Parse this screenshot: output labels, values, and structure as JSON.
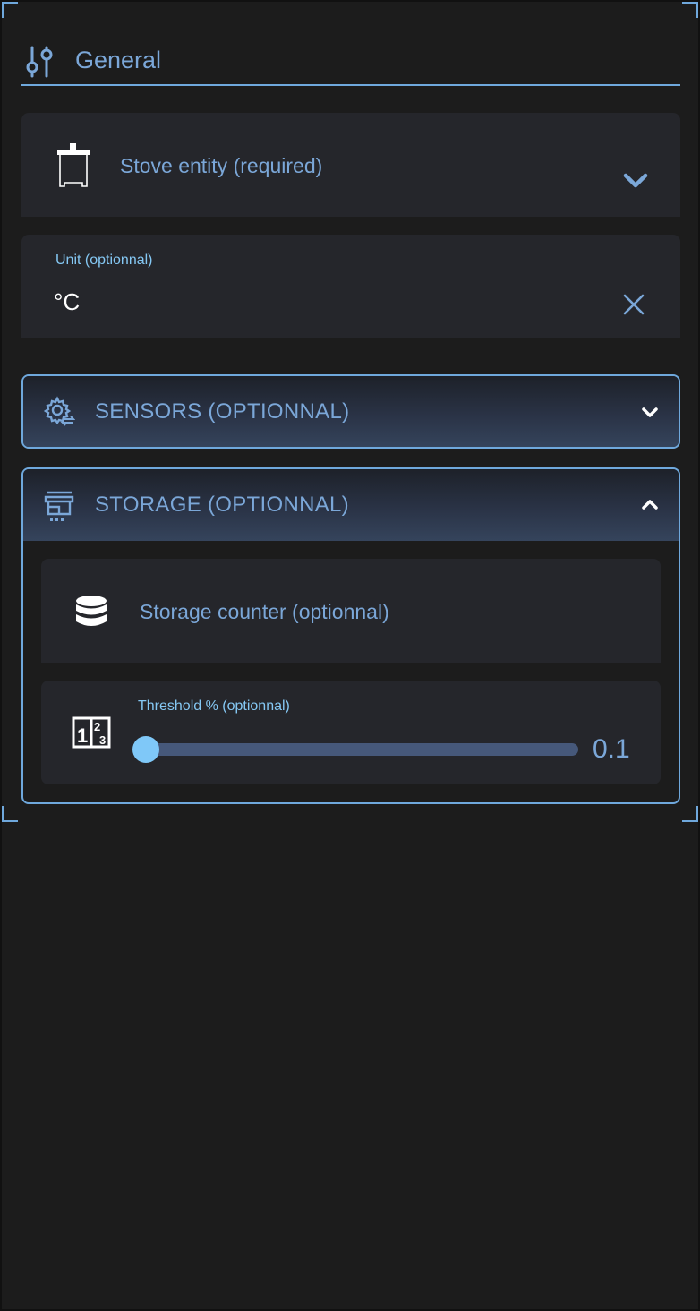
{
  "general": {
    "title": "General",
    "icon": "tune-icon"
  },
  "stove_entity": {
    "label": "Stove entity (required)",
    "icon": "stove-icon"
  },
  "unit": {
    "label": "Unit (optionnal)",
    "value": "°C"
  },
  "sensors": {
    "title": "SENSORS (OPTIONNAL)",
    "expanded": false,
    "icon": "cog-sync-icon"
  },
  "storage": {
    "title": "STORAGE (OPTIONNAL)",
    "expanded": true,
    "icon": "storefront-icon",
    "counter": {
      "label": "Storage counter (optionnal)",
      "icon": "database-icon"
    },
    "threshold": {
      "label": "Threshold % (optionnal)",
      "value": "0.1",
      "icon": "numeric-icon",
      "fill_fraction": 0.0
    }
  },
  "colors": {
    "accent": "#6fa8dc",
    "label_text": "#7ba7d8",
    "field_bg": "#25262b",
    "page_bg": "#1c1c1c",
    "slider_thumb": "#7fc8f8",
    "slider_track": "#46587a"
  }
}
